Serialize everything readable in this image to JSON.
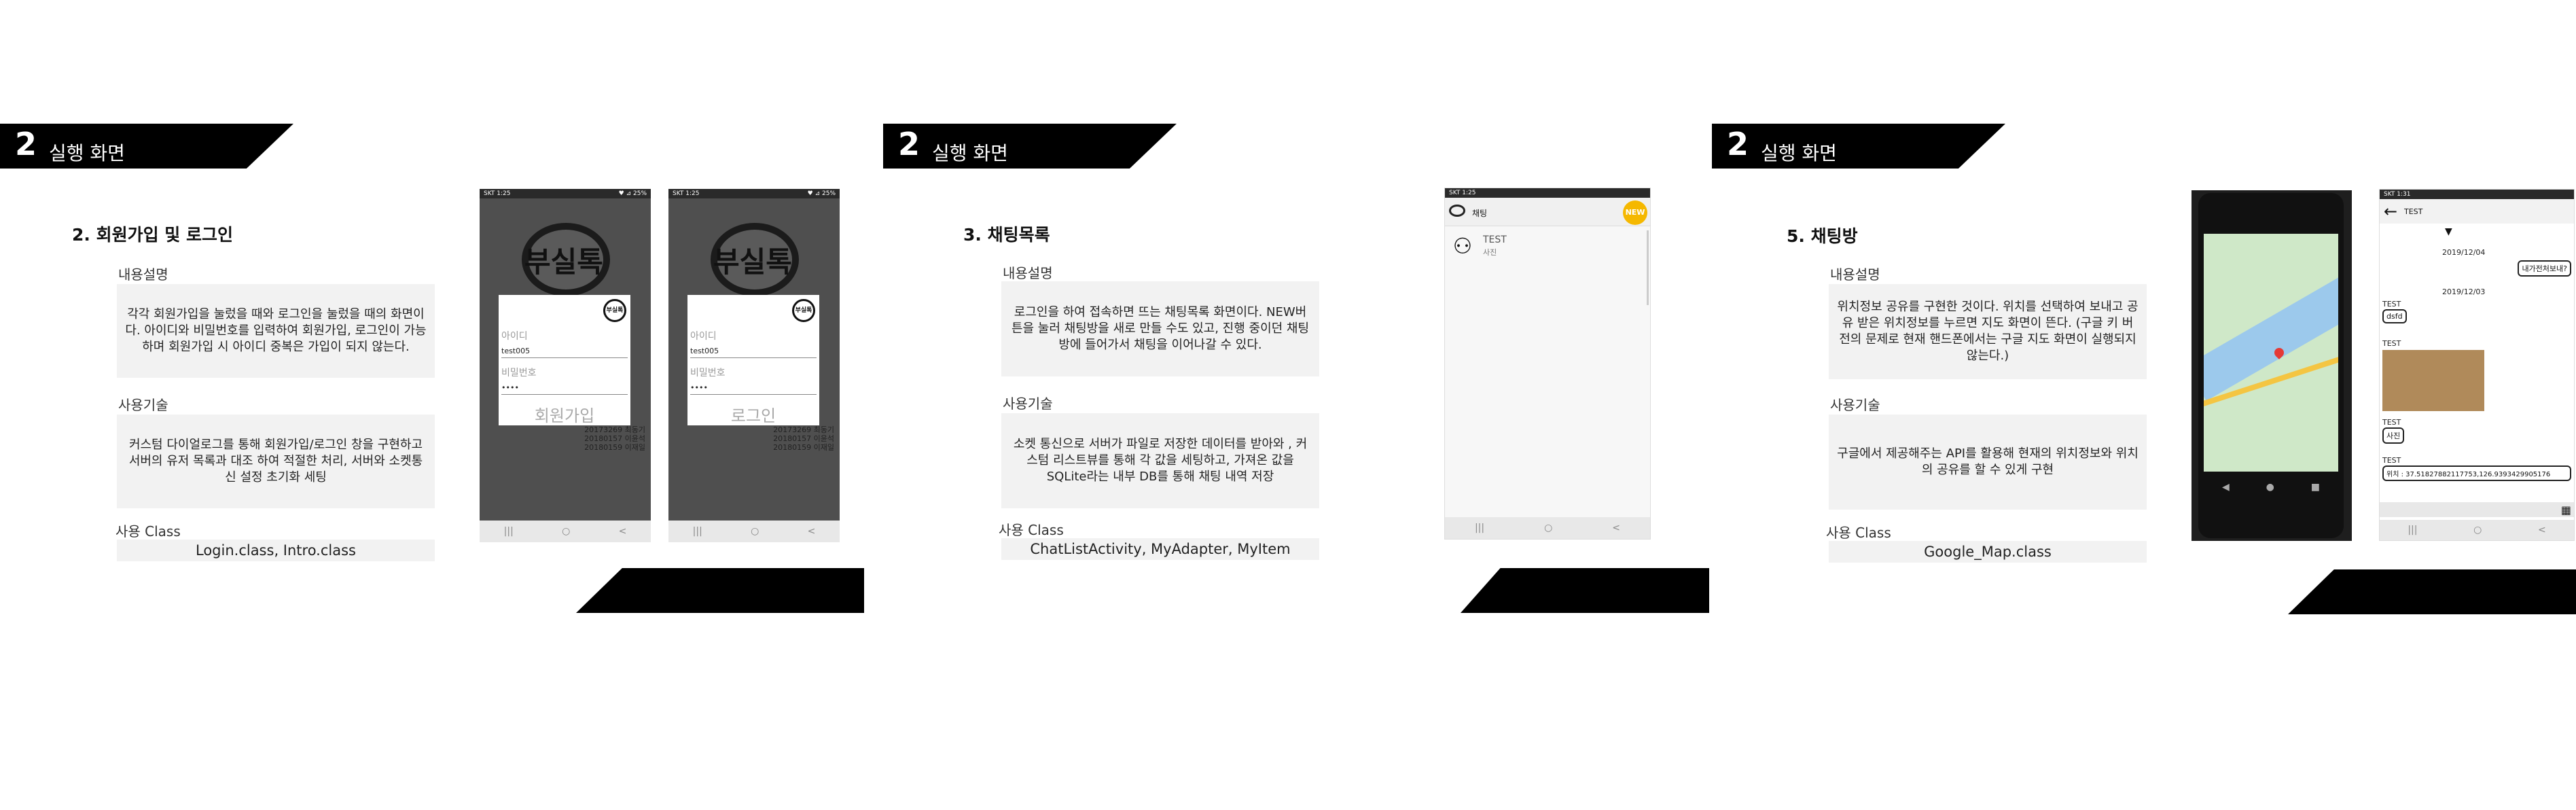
{
  "slides": [
    {
      "banner": {
        "num": "2",
        "text": "실행 화면"
      },
      "title": "2. 회원가입 및 로그인",
      "desc_label": "내용설명",
      "desc": "각각 회원가입을 눌렀을 때와 로그인을 눌렀을 때의 화면이다. 아이디와 비밀번호를 입력하여 회원가입, 로그인이 가능하며 회원가입 시 아이디 중복은 가입이 되지 않는다.",
      "tech_label": "사용기술",
      "tech": "커스텀 다이얼로그를 통해 회원가입/로그인 창을 구현하고 서버의 유저 목록과 대조 하여 적절한 처리, 서버와 소켓통신 설정 초기화 세팅",
      "class_label": "사용 Class",
      "classes": "Login.class,  Intro.class"
    },
    {
      "banner": {
        "num": "2",
        "text": "실행 화면"
      },
      "title": "3. 채팅목록",
      "desc_label": "내용설명",
      "desc": "로그인을 하여 접속하면 뜨는 채팅목록 화면이다. NEW버튼을 눌러 채팅방을 새로 만들 수도 있고, 진행 중이던 채팅방에 들어가서 채팅을 이어나갈 수 있다.",
      "tech_label": "사용기술",
      "tech": "소켓 통신으로 서버가 파일로 저장한 데이터를 받아와 , 커스텀 리스트뷰를 통해 각 값을 세팅하고, 가져온 값을 SQLite라는 내부 DB를 통해 채팅 내역 저장",
      "class_label": "사용 Class",
      "classes": "ChatListActivity,  MyAdapter,  MyItem"
    },
    {
      "banner": {
        "num": "2",
        "text": "실행 화면"
      },
      "title": "5. 채팅방",
      "desc_label": "내용설명",
      "desc": "위치정보 공유를 구현한 것이다. 위치를 선택하여 보내고 공유 받은 위치정보를 누르면 지도 화면이 뜬다. (구글 키 버전의 문제로 현재 핸드폰에서는 구글 지도 화면이 실행되지 않는다.)",
      "tech_label": "사용기술",
      "tech": "구글에서 제공해주는 API를 활용해 현재의 위치정보와 위치의 공유를 할 수 있게 구현",
      "class_label": "사용 Class",
      "classes": "Google_Map.class"
    }
  ],
  "phones": {
    "status_carrier": "SKT 1:25",
    "status_right": "♥ ⊿ 25%",
    "logo": "부실톡",
    "dialog_logo": "부실톡",
    "id_label": "아이디",
    "id_value": "test005",
    "pw_label": "비밀번호",
    "pw_value": "••••",
    "signup_btn": "회원가입",
    "login_btn": "로그인",
    "bg_list": [
      "20173269 최동기",
      "20180157 이윤석",
      "20180159 이재일"
    ],
    "nav": [
      "|||",
      "○",
      "<"
    ]
  },
  "chatlist": {
    "status": "SKT 1:25",
    "header": "채팅",
    "new_btn": "NEW",
    "item_title": "TEST",
    "item_sub": "사진"
  },
  "chatroom": {
    "status": "SKT 1:31",
    "title": "TEST",
    "date1": "2019/12/04",
    "mine": "내가전처보내?",
    "date2": "2019/12/03",
    "sender": "TEST",
    "msg1": "dsfd",
    "msg2_label": "TEST",
    "msg3_label": "TEST",
    "msg3": "사진",
    "msg4_label": "TEST",
    "location": "위치 : 37.51827882117753,126.9393429905176"
  },
  "colors": {
    "banner": "#000000",
    "box": "#f2f2f2",
    "phone_dim": "#4f4f4f",
    "new_badge": "#f5b800",
    "map_pin": "#e53935"
  }
}
